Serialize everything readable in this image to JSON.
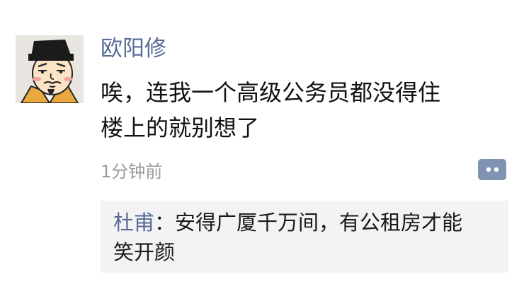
{
  "post": {
    "author": "欧阳修",
    "content_lines": [
      "唉，连我一个高级公务员都没得住",
      "楼上的就别想了"
    ],
    "time": "1分钟前"
  },
  "comment": {
    "author": "杜甫",
    "separator": "：",
    "line1": "安得广厦千万间，有公租房才能",
    "line2": "笑开颜"
  },
  "icons": {
    "avatar": "cartoon-scholar-avatar",
    "comment_button": "comment-bubble-icon"
  },
  "colors": {
    "name_link": "#586b95",
    "comment_bg": "#f3f3f5",
    "icon_bg": "#8093b3"
  }
}
